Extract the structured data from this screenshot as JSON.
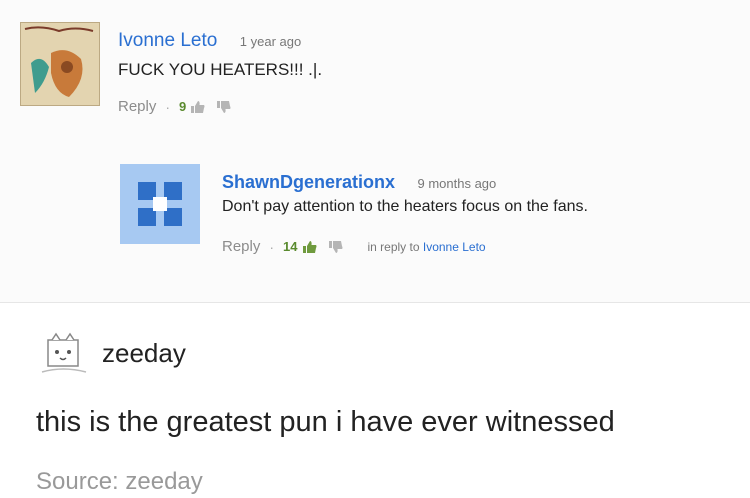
{
  "comments": [
    {
      "author": "Ivonne Leto",
      "time": "1 year ago",
      "text": "FUCK YOU HEATERS!!! .|.",
      "reply_label": "Reply",
      "likes": "9"
    },
    {
      "author": "ShawnDgenerationx",
      "time": "9 months ago",
      "text": "Don't pay attention to the heaters focus on the fans.",
      "reply_label": "Reply",
      "likes": "14",
      "in_reply_prefix": "in reply to",
      "in_reply_name": "Ivonne Leto"
    }
  ],
  "post": {
    "username": "zeeday",
    "text": "this is the greatest pun i have ever witnessed",
    "source": "Source: zeeday"
  },
  "colors": {
    "author_link": "#2a6fd1",
    "like_count": "#5a8a2e"
  }
}
